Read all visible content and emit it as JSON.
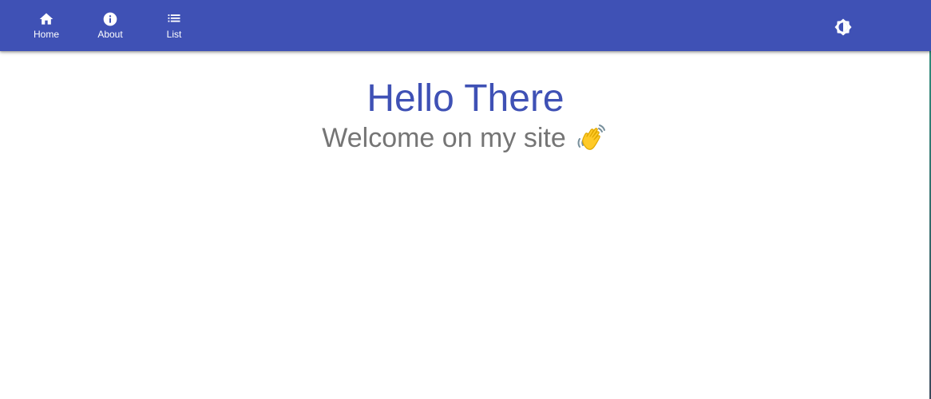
{
  "nav": {
    "items": [
      {
        "label": "Home",
        "icon": "home-icon"
      },
      {
        "label": "About",
        "icon": "info-icon"
      },
      {
        "label": "List",
        "icon": "list-icon"
      }
    ],
    "theme_toggle_icon": "brightness-icon"
  },
  "hero": {
    "title": "Hello There",
    "subtitle": "Welcome on my site",
    "subtitle_icon": "waving-hand-icon"
  },
  "colors": {
    "primary": "#3f51b5",
    "subtitle": "#757575",
    "background": "#ffffff"
  }
}
